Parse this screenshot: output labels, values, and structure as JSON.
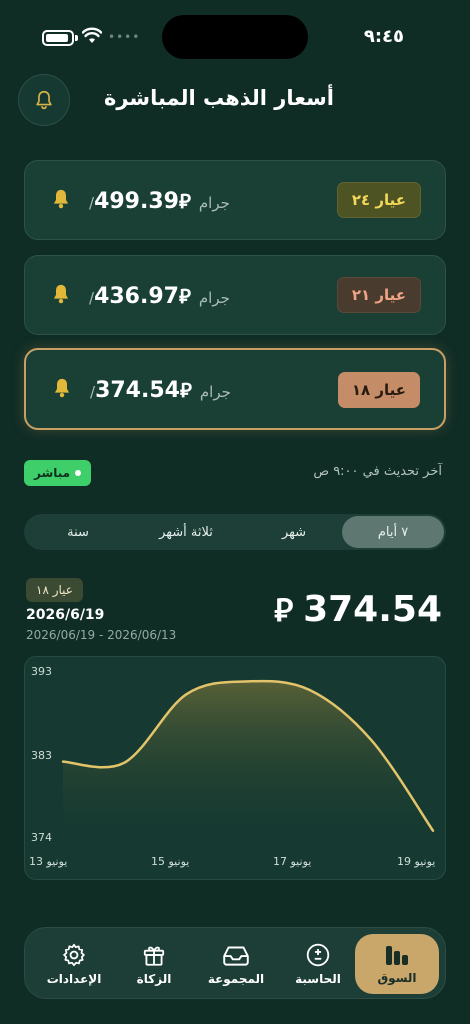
{
  "status_bar": {
    "time": "٩:٤٥"
  },
  "header": {
    "title": "أسعار الذهب المباشرة",
    "bell_icon": "bell-icon"
  },
  "colors": {
    "accent_gold": "#c9a76a",
    "live_green": "#3fcf6a",
    "background": "#0f2c25"
  },
  "karats": [
    {
      "label": "عيار ٢٤",
      "price": "499.39",
      "currency": "⃁",
      "unit": "/جرام",
      "selected": false
    },
    {
      "label": "عيار ٢١",
      "price": "436.97",
      "currency": "⃁",
      "unit": "/جرام",
      "selected": false
    },
    {
      "label": "عيار ١٨",
      "price": "374.54",
      "currency": "⃁",
      "unit": "/جرام",
      "selected": true
    }
  ],
  "status": {
    "live_label": "مباشر",
    "last_update": "آخر تحديث في ٩:٠٠ ص"
  },
  "tabs": [
    {
      "label": "٧ أيام",
      "active": true
    },
    {
      "label": "شهر",
      "active": false
    },
    {
      "label": "ثلاثة أشهر",
      "active": false
    },
    {
      "label": "سنة",
      "active": false
    }
  ],
  "chart_header": {
    "karat_badge": "عيار ١٨",
    "date": "2026/6/19",
    "range": "2026/06/19 - 2026/06/13",
    "price": "374.54",
    "currency": "⃁"
  },
  "chart_data": {
    "type": "area",
    "x": [
      "13 يونيو",
      "14 يونيو",
      "15 يونيو",
      "16 يونيو",
      "17 يونيو",
      "18 يونيو",
      "19 يونيو"
    ],
    "values": [
      382.5,
      382.4,
      390.3,
      391.8,
      390.8,
      385.0,
      374.5
    ],
    "x_tick_labels": [
      "13 يونيو",
      "15 يونيو",
      "17 يونيو",
      "19 يونيو"
    ],
    "y_tick_labels": [
      "393",
      "383",
      "374"
    ],
    "ylim": [
      374,
      393
    ],
    "line_color": "#e3c46a",
    "grid": false
  },
  "nav": [
    {
      "label": "السوق",
      "icon": "bar-chart-icon",
      "active": true
    },
    {
      "label": "الحاسبة",
      "icon": "calculator-icon",
      "active": false
    },
    {
      "label": "المجموعة",
      "icon": "tray-icon",
      "active": false
    },
    {
      "label": "الزكاة",
      "icon": "gift-icon",
      "active": false
    },
    {
      "label": "الإعدادات",
      "icon": "gear-icon",
      "active": false
    }
  ]
}
